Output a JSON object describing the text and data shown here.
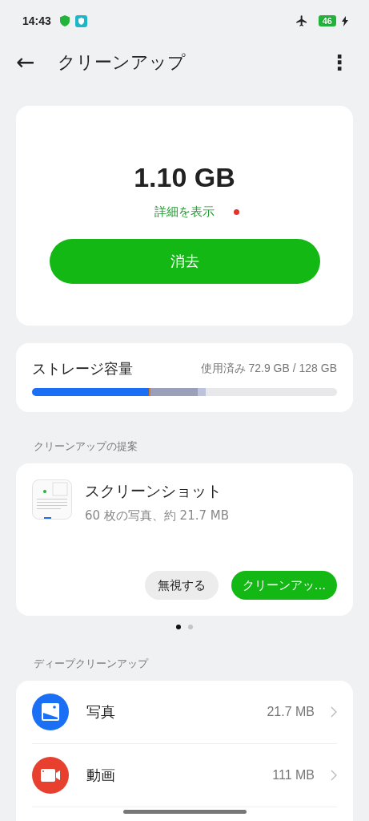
{
  "status_bar": {
    "time": "14:43",
    "battery": "46"
  },
  "header": {
    "back": "←",
    "title": "クリーンアップ",
    "menu": "⋮"
  },
  "summary": {
    "size": "1.10 GB",
    "details_link": "詳細を表示",
    "new_dot": true,
    "button": "消去"
  },
  "storage": {
    "title": "ストレージ容量",
    "usage": "使用済み 72.9 GB / 128 GB",
    "level": 0.57
  },
  "suggestions": {
    "heading": "クリーンアップの提案",
    "card": {
      "title": "スクリーンショット",
      "subtitle": "60 枚の写真、約 21.7 MB",
      "ignore_button": "無視する",
      "clean_button": "クリーンアッ..."
    },
    "pages": [
      {
        "selected": true
      },
      {
        "selected": false
      }
    ]
  },
  "deep_cleanup": {
    "heading": "ディープクリーンアップ",
    "items": [
      {
        "kind": "photo",
        "color": "#1a6ff5",
        "label": "写真",
        "size": "21.7 MB"
      },
      {
        "kind": "video",
        "color": "#e8402f",
        "label": "動画",
        "size": "111 MB"
      }
    ]
  }
}
